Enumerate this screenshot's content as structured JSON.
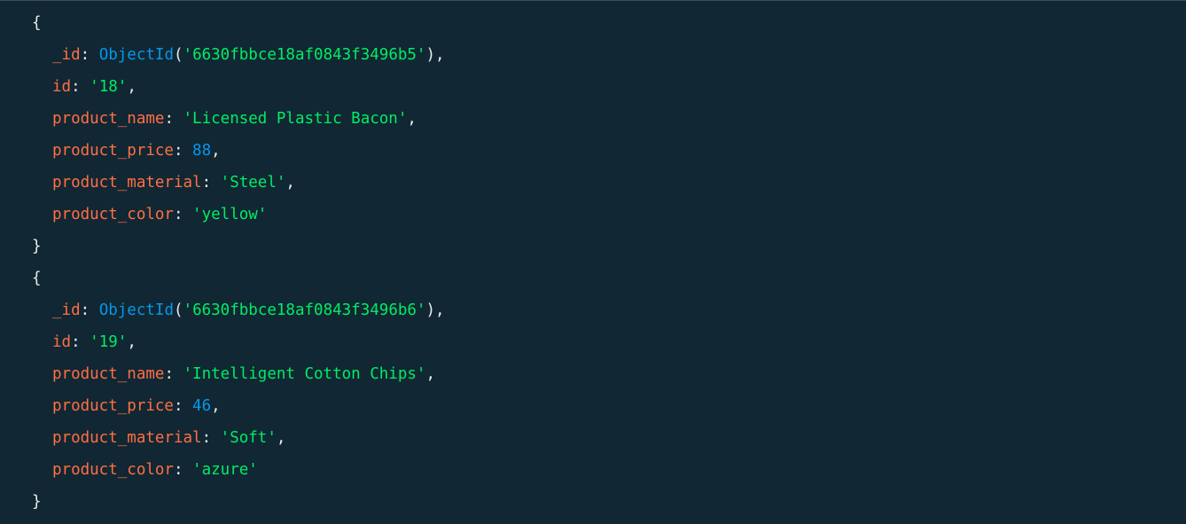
{
  "colors": {
    "background": "#112733",
    "key": "#ff6f44",
    "string": "#00ed64",
    "number": "#0498ec",
    "function": "#0498ec",
    "punctuation": "#e8edeb"
  },
  "documents": [
    {
      "open_brace": "{",
      "close_brace": "}",
      "fields": {
        "oid": {
          "key": "_id",
          "fn": "ObjectId",
          "value": "'6630fbbce18af0843f3496b5'"
        },
        "id": {
          "key": "id",
          "value": "'18'"
        },
        "product_name": {
          "key": "product_name",
          "value": "'Licensed Plastic Bacon'"
        },
        "product_price": {
          "key": "product_price",
          "value": "88"
        },
        "product_material": {
          "key": "product_material",
          "value": "'Steel'"
        },
        "product_color": {
          "key": "product_color",
          "value": "'yellow'"
        }
      }
    },
    {
      "open_brace": "{",
      "close_brace": "}",
      "fields": {
        "oid": {
          "key": "_id",
          "fn": "ObjectId",
          "value": "'6630fbbce18af0843f3496b6'"
        },
        "id": {
          "key": "id",
          "value": "'19'"
        },
        "product_name": {
          "key": "product_name",
          "value": "'Intelligent Cotton Chips'"
        },
        "product_price": {
          "key": "product_price",
          "value": "46"
        },
        "product_material": {
          "key": "product_material",
          "value": "'Soft'"
        },
        "product_color": {
          "key": "product_color",
          "value": "'azure'"
        }
      }
    }
  ]
}
